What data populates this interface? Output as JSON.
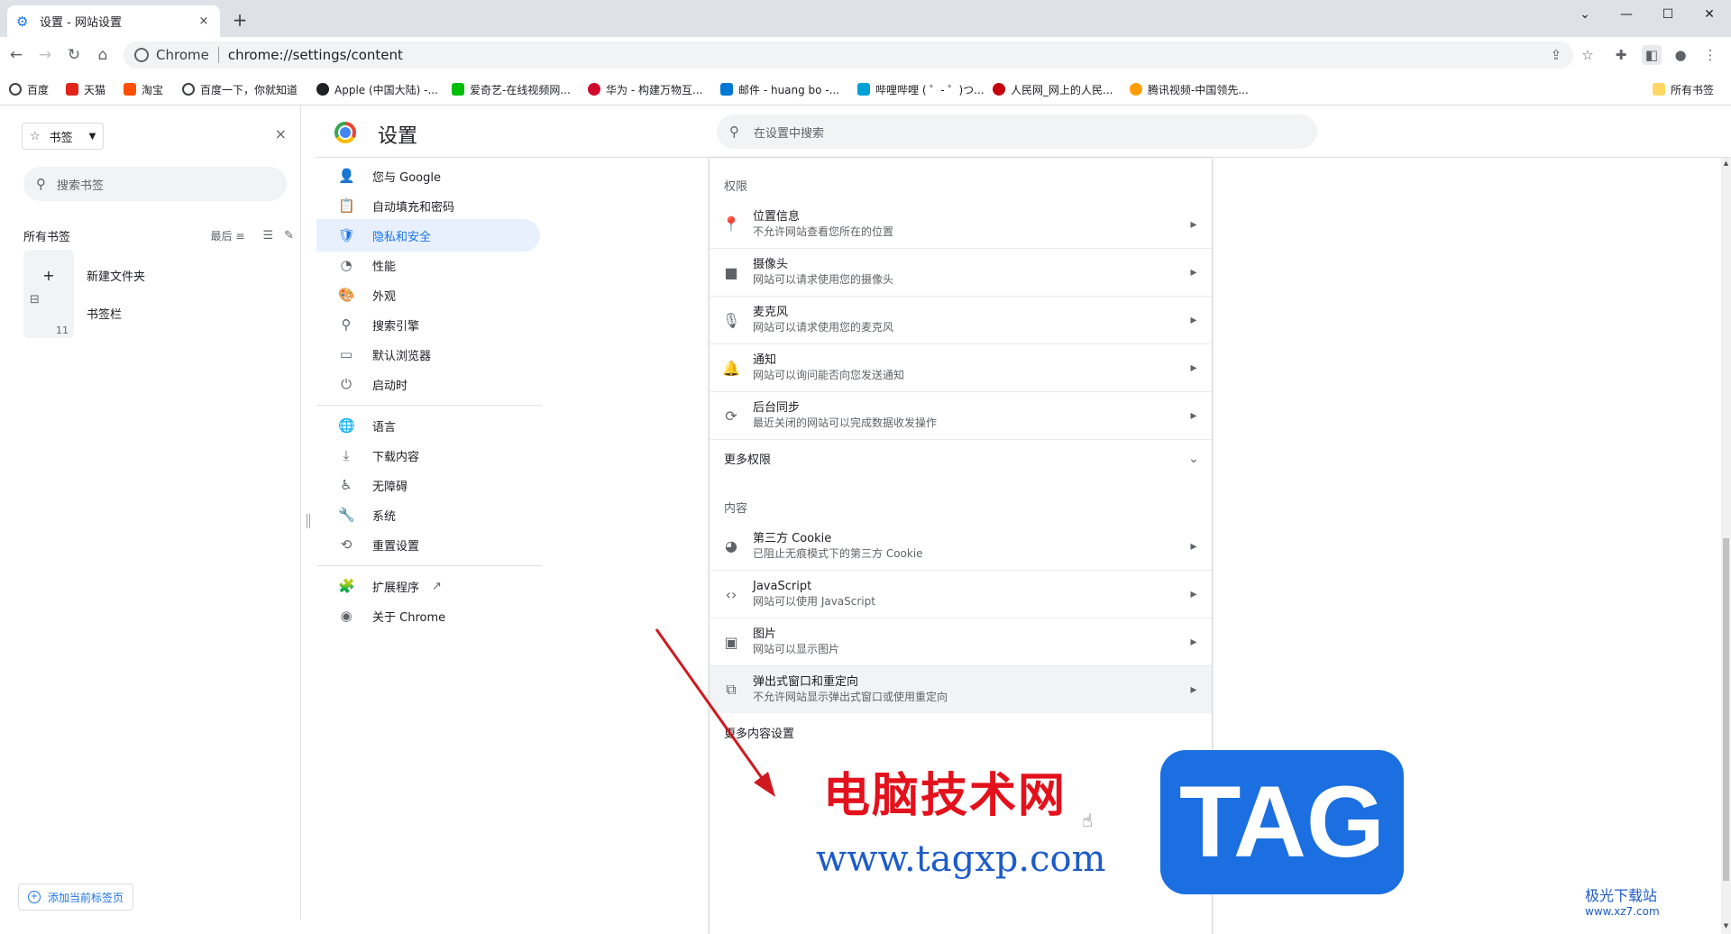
{
  "window": {
    "tab_title": "设置 - 网站设置",
    "tab_close": "×",
    "new_tab": "+",
    "controls": [
      "⌄",
      "—",
      "☐",
      "✕"
    ]
  },
  "toolbar": {
    "back": "←",
    "forward": "→",
    "reload": "↻",
    "home": "⌂",
    "chip_label": "Chrome",
    "url": "chrome://settings/content",
    "right_icons": [
      "share-icon",
      "star-icon",
      "extensions-icon",
      "side-panel-icon",
      "profile-icon",
      "menu-icon"
    ]
  },
  "bookmarks_bar": {
    "items": [
      {
        "label": "百度",
        "color": "#3c4043"
      },
      {
        "label": "天猫",
        "color": "#e1251b"
      },
      {
        "label": "淘宝",
        "color": "#ff5000"
      },
      {
        "label": "百度一下，你就知道",
        "color": "#3c4043"
      },
      {
        "label": "Apple (中国大陆) -...",
        "color": "#202124"
      },
      {
        "label": "爱奇艺-在线视频网...",
        "color": "#00be06"
      },
      {
        "label": "华为 - 构建万物互...",
        "color": "#cf0a2c"
      },
      {
        "label": "邮件 - huang bo -...",
        "color": "#0078d4"
      },
      {
        "label": "哔哩哔哩 ( ゜- ゜)つ...",
        "color": "#00a1d6"
      },
      {
        "label": "人民网_网上的人民...",
        "color": "#c4000f"
      },
      {
        "label": "腾讯视频-中国领先...",
        "color": "#ff9c00"
      }
    ],
    "all_bookmarks": "所有书签"
  },
  "side_panel": {
    "dropdown_label": "书签",
    "close": "×",
    "search_placeholder": "搜索书签",
    "all_bookmarks": "所有书签",
    "sort_label": "最后",
    "items": [
      {
        "label": "新建文件夹",
        "icon": "+"
      },
      {
        "label": "书签栏",
        "count": "11"
      }
    ],
    "add_button": "添加当前标签页"
  },
  "settings": {
    "title": "设置",
    "search_placeholder": "在设置中搜索",
    "nav": [
      {
        "label": "您与 Google",
        "icon": "person-icon",
        "glyph": "👤"
      },
      {
        "label": "自动填充和密码",
        "icon": "clipboard-icon",
        "glyph": "📋"
      },
      {
        "label": "隐私和安全",
        "icon": "shield-icon",
        "glyph": "🛡"
      },
      {
        "label": "性能",
        "icon": "speedometer-icon",
        "glyph": "◔"
      },
      {
        "label": "外观",
        "icon": "palette-icon",
        "glyph": "🎨"
      },
      {
        "label": "搜索引擎",
        "icon": "search-icon",
        "glyph": "⚲"
      },
      {
        "label": "默认浏览器",
        "icon": "browser-icon",
        "glyph": "▭"
      },
      {
        "label": "启动时",
        "icon": "power-icon",
        "glyph": "⏻"
      },
      {
        "label": "语言",
        "icon": "globe-icon",
        "glyph": "🌐"
      },
      {
        "label": "下载内容",
        "icon": "download-icon",
        "glyph": "⤓"
      },
      {
        "label": "无障碍",
        "icon": "accessibility-icon",
        "glyph": "♿"
      },
      {
        "label": "系统",
        "icon": "wrench-icon",
        "glyph": "🔧"
      },
      {
        "label": "重置设置",
        "icon": "history-icon",
        "glyph": "⟲"
      },
      {
        "label": "扩展程序",
        "icon": "puzzle-icon",
        "glyph": "🧩",
        "external": "↗"
      },
      {
        "label": "关于 Chrome",
        "icon": "chrome-icon",
        "glyph": "◉"
      }
    ],
    "active_nav": "隐私和安全",
    "permissions_title": "权限",
    "permissions": [
      {
        "title": "位置信息",
        "desc": "不允许网站查看您所在的位置",
        "icon": "location-icon",
        "glyph": "📍"
      },
      {
        "title": "摄像头",
        "desc": "网站可以请求使用您的摄像头",
        "icon": "camera-icon",
        "glyph": "■"
      },
      {
        "title": "麦克风",
        "desc": "网站可以请求使用您的麦克风",
        "icon": "mic-icon",
        "glyph": "🎙"
      },
      {
        "title": "通知",
        "desc": "网站可以询问能否向您发送通知",
        "icon": "bell-icon",
        "glyph": "🔔"
      },
      {
        "title": "后台同步",
        "desc": "最近关闭的网站可以完成数据收发操作",
        "icon": "sync-icon",
        "glyph": "⟳"
      }
    ],
    "more_permissions": "更多权限",
    "content_title": "内容",
    "content": [
      {
        "title": "第三方 Cookie",
        "desc": "已阻止无痕模式下的第三方 Cookie",
        "icon": "cookie-icon",
        "glyph": "◕"
      },
      {
        "title": "JavaScript",
        "desc": "网站可以使用 JavaScript",
        "icon": "code-icon",
        "glyph": "‹›"
      },
      {
        "title": "图片",
        "desc": "网站可以显示图片",
        "icon": "image-icon",
        "glyph": "▣"
      },
      {
        "title": "弹出式窗口和重定向",
        "desc": "不允许网站显示弹出式窗口或使用重定向",
        "icon": "open-in-new-icon",
        "glyph": "⧉"
      }
    ],
    "more_content": "更多内容设置"
  },
  "watermark": {
    "text": "电脑技术网",
    "url": "www.tagxp.com",
    "tag": "TAG",
    "logo_text": "极光下载站",
    "logo_url": "www.xz7.com"
  }
}
